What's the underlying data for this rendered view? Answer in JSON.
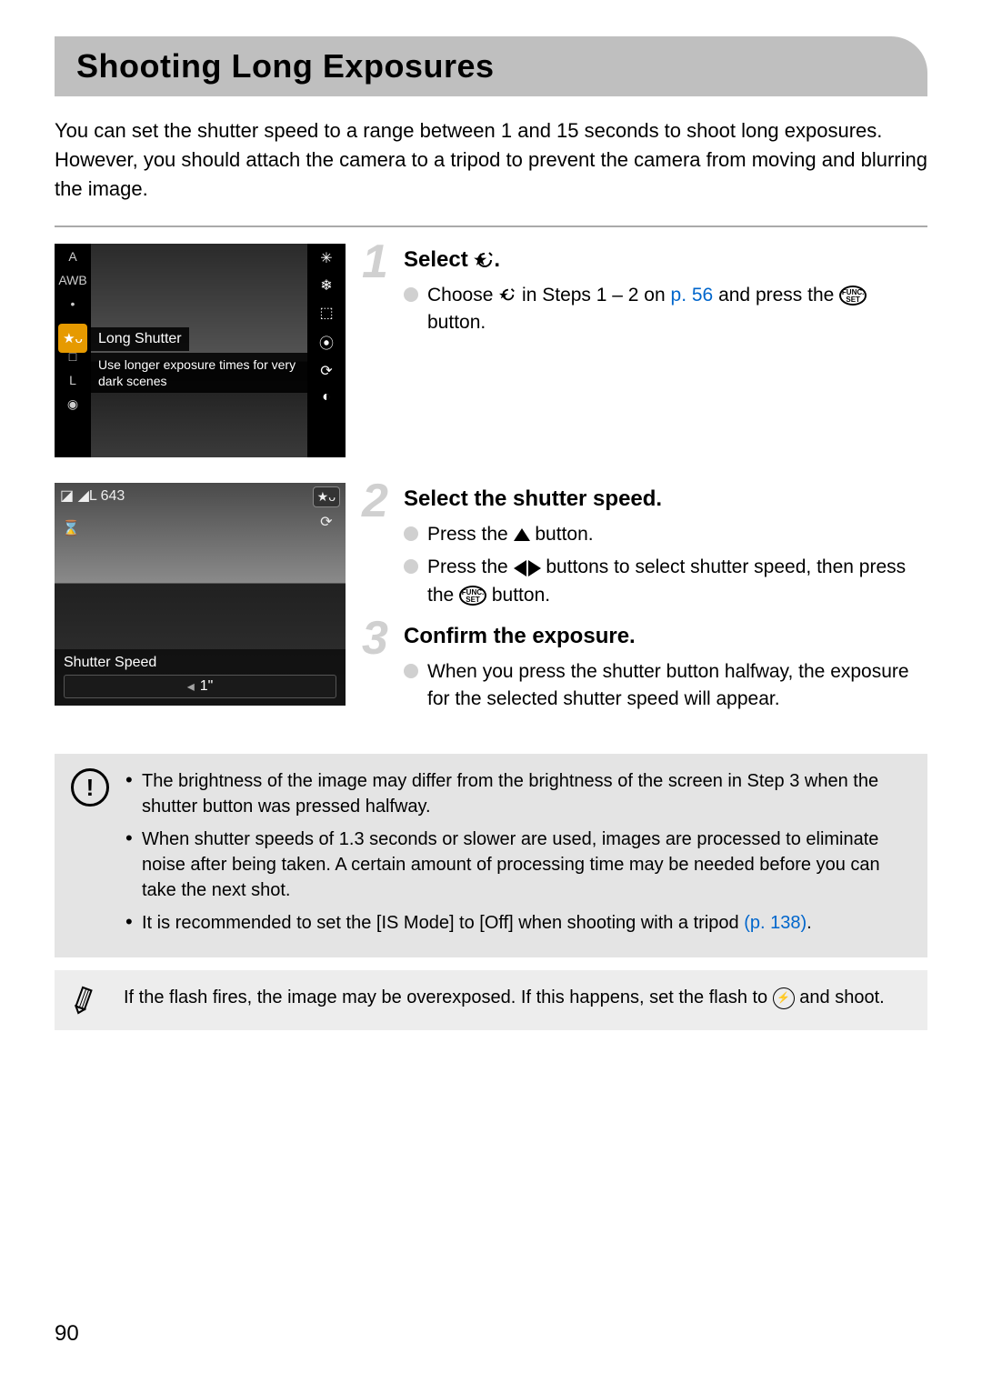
{
  "title": "Shooting Long Exposures",
  "intro": "You can set the shutter speed to a range between 1 and 15 seconds to shoot long exposures. However, you should attach the camera to a tripod to prevent the camera from moving and blurring the image.",
  "lcd1": {
    "mode_label": "Long Shutter",
    "tooltip": "Use longer exposure times for very dark scenes",
    "left_icons": [
      "AUTO",
      "AWB",
      "•",
      "★ᴗ",
      "□",
      "L",
      "◉"
    ],
    "right_icons": [
      "✳",
      "❄",
      "⬚",
      "⦿",
      "⟳",
      "◐"
    ]
  },
  "lcd2": {
    "top_left": "◪  ◢L  643",
    "top_right_badge": "★ᴗ",
    "top_right_timer": "⟳",
    "footer_label": "Shutter Speed",
    "slider_value": "1\"",
    "timer_icon": "⌛"
  },
  "steps": [
    {
      "num": "1",
      "title_pre": "Select ",
      "title_icon": "star-timer",
      "title_post": ".",
      "bullets": [
        {
          "segments": [
            {
              "t": "text",
              "v": "Choose "
            },
            {
              "t": "icon",
              "v": "star-timer"
            },
            {
              "t": "text",
              "v": " in Steps 1 – 2 on "
            },
            {
              "t": "link",
              "v": "p. 56"
            },
            {
              "t": "text",
              "v": " and press the "
            },
            {
              "t": "icon",
              "v": "func-set"
            },
            {
              "t": "text",
              "v": " button."
            }
          ]
        }
      ]
    },
    {
      "num": "2",
      "title": "Select the shutter speed.",
      "bullets": [
        {
          "segments": [
            {
              "t": "text",
              "v": "Press the "
            },
            {
              "t": "icon",
              "v": "tri-up"
            },
            {
              "t": "text",
              "v": " button."
            }
          ]
        },
        {
          "segments": [
            {
              "t": "text",
              "v": "Press the "
            },
            {
              "t": "icon",
              "v": "arrows-lr"
            },
            {
              "t": "text",
              "v": " buttons to select shutter speed, then press the "
            },
            {
              "t": "icon",
              "v": "func-set"
            },
            {
              "t": "text",
              "v": " button."
            }
          ]
        }
      ]
    },
    {
      "num": "3",
      "title": "Confirm the exposure.",
      "bullets": [
        {
          "segments": [
            {
              "t": "text",
              "v": "When you press the shutter button halfway, the exposure for the selected shutter speed will appear."
            }
          ]
        }
      ]
    }
  ],
  "caution_notes": [
    "The brightness of the image may differ from the brightness of the screen in Step 3 when the shutter button was pressed halfway.",
    "When shutter speeds of 1.3 seconds or slower are used, images are processed to eliminate noise after being taken. A certain amount of processing time may be needed before you can take the next shot."
  ],
  "caution_note_is": {
    "pre": "It is recommended to set the [IS Mode] to [Off] when shooting with a tripod ",
    "link": "(p. 138)",
    "post": "."
  },
  "tip_note": {
    "pre": "If the flash fires, the image may be overexposed. If this happens, set the flash to ",
    "icon": "flash-off",
    "post": " and shoot."
  },
  "page_number": "90"
}
